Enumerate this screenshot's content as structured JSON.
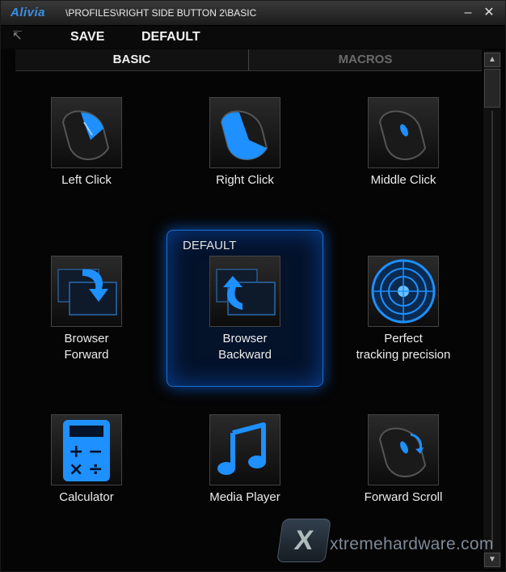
{
  "window": {
    "logo": "Alivia",
    "path": "\\PROFILES\\RIGHT SIDE BUTTON 2\\BASIC",
    "minimize_label": "–",
    "close_label": "✕"
  },
  "toolbar": {
    "back_icon": "↸",
    "save_label": "SAVE",
    "default_label": "DEFAULT"
  },
  "tabs": [
    {
      "label": "BASIC",
      "active": true
    },
    {
      "label": "MACROS",
      "active": false
    }
  ],
  "highlight": {
    "label": "DEFAULT"
  },
  "actions": [
    {
      "label": "Left Click",
      "icon": "mouse-left-click-icon"
    },
    {
      "label": "Right Click",
      "icon": "mouse-right-click-icon"
    },
    {
      "label": "Middle Click",
      "icon": "mouse-middle-click-icon"
    },
    {
      "label": "Browser\nForward",
      "icon": "browser-forward-icon"
    },
    {
      "label": "Browser\nBackward",
      "icon": "browser-backward-icon"
    },
    {
      "label": "Perfect\ntracking precision",
      "icon": "target-icon"
    },
    {
      "label": "Calculator",
      "icon": "calculator-icon"
    },
    {
      "label": "Media Player",
      "icon": "music-note-icon"
    },
    {
      "label": "Forward Scroll",
      "icon": "scroll-forward-icon"
    }
  ],
  "watermark": {
    "mark": "X",
    "text": "xtremehardware.com"
  },
  "colors": {
    "accent": "#1e90ff",
    "glow": "#0a4fb0",
    "background": "#050505"
  }
}
